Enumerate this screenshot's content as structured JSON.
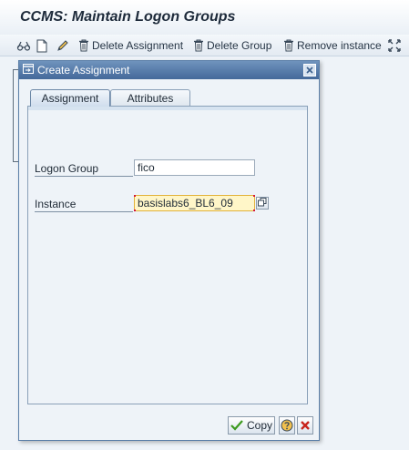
{
  "window": {
    "title": "CCMS: Maintain Logon Groups"
  },
  "toolbar": {
    "delete_assignment_label": "Delete Assignment",
    "delete_group_label": "Delete Group",
    "remove_instance_label": "Remove instance"
  },
  "dialog": {
    "title": "Create Assignment",
    "tabs": [
      {
        "label": "Assignment",
        "active": true
      },
      {
        "label": "Attributes",
        "active": false
      }
    ],
    "fields": {
      "logon_group": {
        "label": "Logon Group",
        "value": "fico"
      },
      "instance": {
        "label": "Instance",
        "value": "basislabs6_BL6_09",
        "required": true
      }
    },
    "buttons": {
      "copy_label": "Copy"
    }
  },
  "colors": {
    "dialog_title_bg": "#44699a",
    "required_field_bg": "#fff6c8",
    "required_marker": "#d4163c",
    "confirm_check": "#3c9a1f",
    "cancel_x": "#c8241c"
  },
  "icons": [
    "other-object-icon",
    "create-icon",
    "change-icon",
    "trash-icon",
    "expand-icon",
    "dialog-window-icon",
    "close-icon",
    "possible-entries-icon",
    "check-icon",
    "help-icon",
    "cancel-icon"
  ]
}
